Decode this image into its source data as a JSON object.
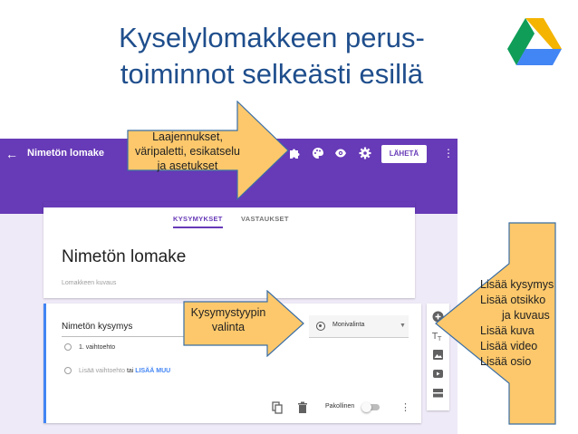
{
  "slide": {
    "title_line1": "Kyselylomakkeen perus-",
    "title_line2": "toiminnot selkeästi esillä"
  },
  "logo": {
    "name": "google-drive-logo",
    "colors": [
      "#f4b400",
      "#0f9d58",
      "#4285f4"
    ]
  },
  "forms": {
    "header": {
      "form_name": "Nimetön lomake",
      "send_label": "LÄHETÄ",
      "icons": [
        "back-arrow-icon",
        "puzzle-icon",
        "palette-icon",
        "eye-icon",
        "gear-icon",
        "more-vert-icon"
      ],
      "color": "#673ab7"
    },
    "tabs": [
      {
        "label": "KYSYMYKSET",
        "active": true
      },
      {
        "label": "VASTAUKSET",
        "active": false
      }
    ],
    "form_title": "Nimetön lomake",
    "form_description": "Lomakkeen kuvaus",
    "question": {
      "title": "Nimetön kysymys",
      "type": "Monivalinta",
      "options": [
        "1. vaihtoehto"
      ],
      "add_option": "Lisää vaihtoehto",
      "add_option_joiner": "tai",
      "add_other": "LISÄÄ MUU",
      "required_label": "Pakollinen",
      "required": false
    },
    "side_toolbar": [
      "add-question-icon",
      "add-title-icon",
      "add-image-icon",
      "add-video-icon",
      "add-section-icon"
    ]
  },
  "callouts": {
    "top": {
      "lines": [
        "Laajennukset,",
        "väripaletti, esikatselu",
        "ja asetukset"
      ]
    },
    "question_type": {
      "lines": [
        "Kysymystyypin",
        "valinta"
      ]
    },
    "right": {
      "lines": [
        "Lisää kysymys",
        "Lisää otsikko",
        "ja kuvaus",
        "Lisää kuva",
        "Lisää video",
        "Lisää osio"
      ]
    },
    "fill_color": "#fdc86b",
    "border_color": "#3a6ea5"
  }
}
